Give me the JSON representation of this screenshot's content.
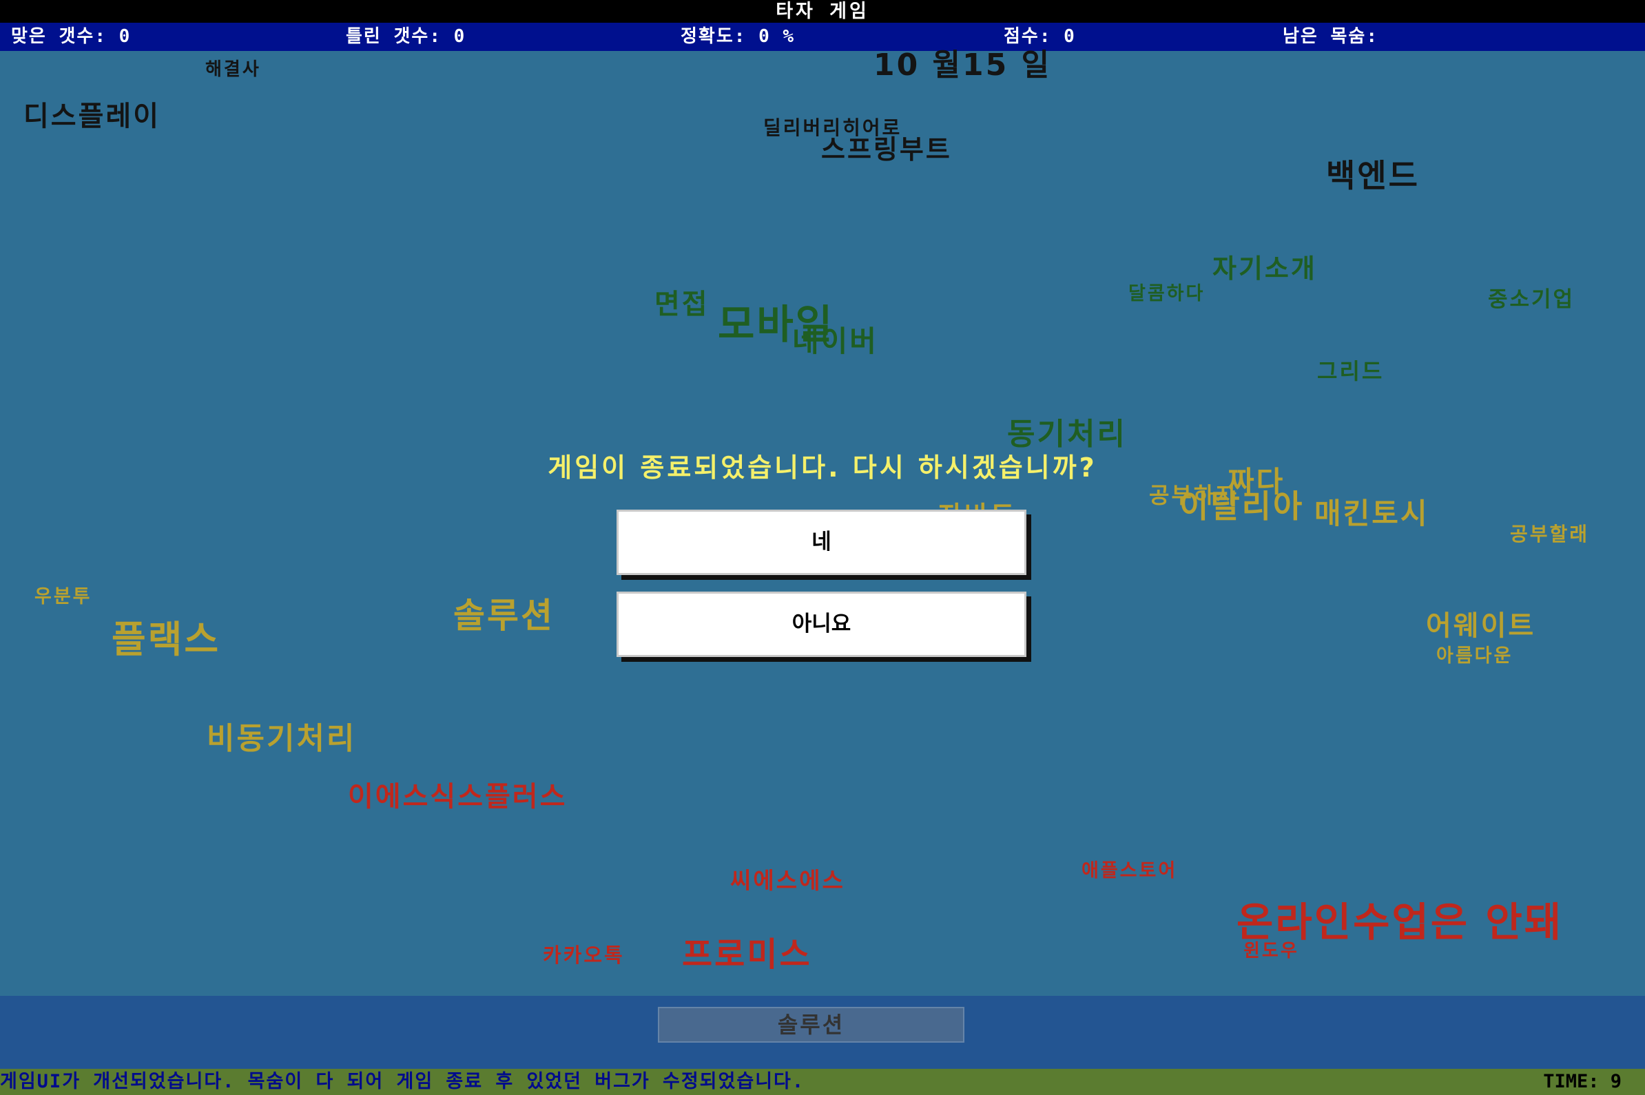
{
  "title": "타자 게임",
  "status": {
    "correct_label": "맞은 갯수:",
    "correct_value": "0",
    "wrong_label": "틀린 갯수:",
    "wrong_value": "0",
    "accuracy_label": "정확도:",
    "accuracy_value": "0 %",
    "score_label": "점수:",
    "score_value": "0",
    "lives_label": "남은 목숨:",
    "lives_value": ""
  },
  "colors": {
    "black": "#141414",
    "green": "#1f5e22",
    "yellow": "#b9a12f",
    "red": "#c0271c"
  },
  "words": [
    {
      "text": "10 월15 일",
      "color": "black"
    },
    {
      "text": "해결사",
      "color": "black"
    },
    {
      "text": "디스플레이",
      "color": "black"
    },
    {
      "text": "딜리버리히어로",
      "color": "black"
    },
    {
      "text": "스프링부트",
      "color": "black"
    },
    {
      "text": "백엔드",
      "color": "black"
    },
    {
      "text": "자기소개",
      "color": "green"
    },
    {
      "text": "면접",
      "color": "green"
    },
    {
      "text": "달콤하다",
      "color": "green"
    },
    {
      "text": "중소기업",
      "color": "green"
    },
    {
      "text": "모바일",
      "color": "green"
    },
    {
      "text": "네이버",
      "color": "green"
    },
    {
      "text": "그리드",
      "color": "green"
    },
    {
      "text": "동기처리",
      "color": "green"
    },
    {
      "text": "짜다",
      "color": "yellow"
    },
    {
      "text": "공부하자",
      "color": "yellow"
    },
    {
      "text": "이탈리아",
      "color": "yellow"
    },
    {
      "text": "매킨토시",
      "color": "yellow"
    },
    {
      "text": "자바토",
      "color": "yellow"
    },
    {
      "text": "공부할래",
      "color": "yellow"
    },
    {
      "text": "우분투",
      "color": "yellow"
    },
    {
      "text": "솔루션",
      "color": "yellow"
    },
    {
      "text": "플랙스",
      "color": "yellow"
    },
    {
      "text": "어웨이트",
      "color": "yellow"
    },
    {
      "text": "아름다운",
      "color": "yellow"
    },
    {
      "text": "비동기처리",
      "color": "yellow"
    },
    {
      "text": "이에스식스플러스",
      "color": "red"
    },
    {
      "text": "씨에스에스",
      "color": "red"
    },
    {
      "text": "애플스토어",
      "color": "red"
    },
    {
      "text": "온라인수업은 안돼",
      "color": "red"
    },
    {
      "text": "카카오톡",
      "color": "red"
    },
    {
      "text": "프로미스",
      "color": "red"
    },
    {
      "text": "윈도우",
      "color": "red"
    }
  ],
  "dialog": {
    "message": "게임이 종료되었습니다. 다시 하시겠습니까?",
    "yes_label": "네",
    "no_label": "아니요"
  },
  "input": {
    "value": "솔루션"
  },
  "notice": {
    "text": "게임UI가 개선되었습니다. 목숨이 다 되어 게임 종료 후 있었던 버그가 수정되었습니다.",
    "timer_label": "TIME:",
    "timer_value": "9"
  }
}
